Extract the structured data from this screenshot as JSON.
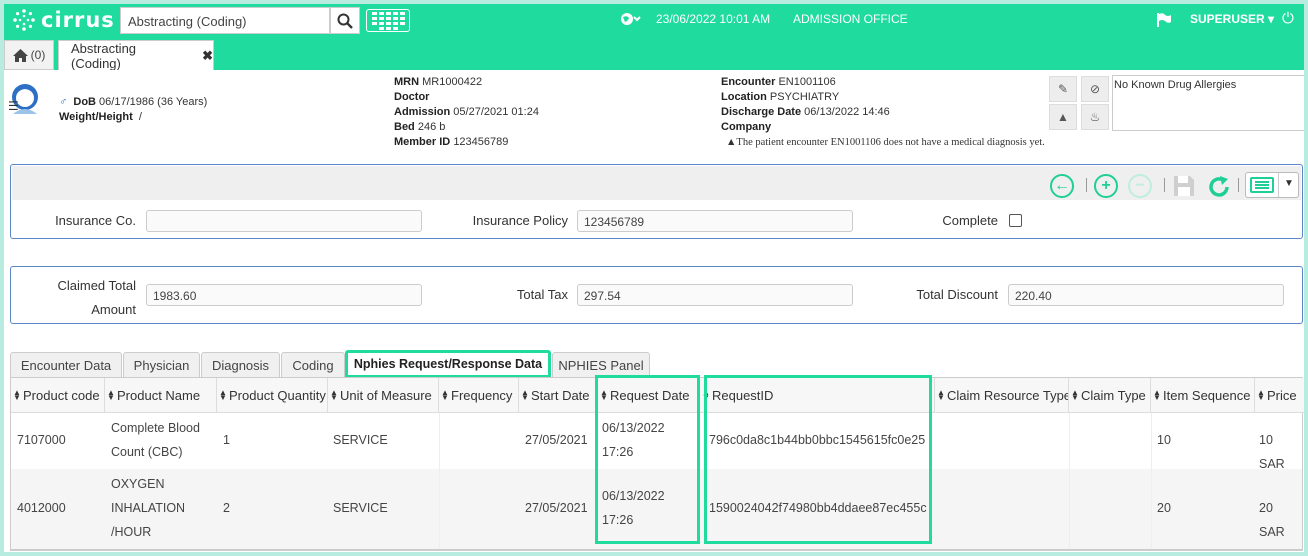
{
  "app": {
    "brand": "cirrus",
    "search_value": "Abstracting (Coding)",
    "datetime": "23/06/2022 10:01 AM",
    "office": "ADMISSION OFFICE",
    "user": "SUPERUSER",
    "accent": "#1fdb9e"
  },
  "tabs": {
    "home_label": "(0)",
    "work_label": "Abstracting (Coding)"
  },
  "patient": {
    "sex_symbol": "♂",
    "dob_label": "DoB",
    "dob": "06/17/1986 (36 Years)",
    "weight_label": "Weight/Height",
    "weight": "/",
    "mrn_label": "MRN",
    "mrn": "MR1000422",
    "doctor_label": "Doctor",
    "doctor": "",
    "admission_label": "Admission",
    "admission": "05/27/2021 01:24",
    "bed_label": "Bed",
    "bed": "246 b",
    "member_label": "Member ID",
    "member": "123456789",
    "encounter_label": "Encounter",
    "encounter": "EN1001106",
    "location_label": "Location",
    "location": "PSYCHIATRY",
    "discharge_label": "Discharge Date",
    "discharge": "06/13/2022 14:46",
    "company_label": "Company",
    "company": "",
    "warning": "The patient encounter EN1001106 does not have a medical diagnosis yet.",
    "allergy": "No Known Drug Allergies"
  },
  "form1": {
    "insurance_co_label": "Insurance Co.",
    "insurance_co": "",
    "policy_label": "Insurance Policy",
    "policy": "123456789",
    "complete_label": "Complete"
  },
  "form2": {
    "claimed_label": "Claimed Total Amount",
    "claimed_line1": "Claimed Total",
    "claimed_line2": "Amount",
    "claimed": "1983.60",
    "tax_label": "Total Tax",
    "tax": "297.54",
    "discount_label": "Total Discount",
    "discount": "220.40"
  },
  "detail_tabs": [
    "Encounter Data",
    "Physician",
    "Diagnosis",
    "Coding",
    "Nphies Request/Response Data",
    "NPHIES Panel"
  ],
  "table": {
    "headers": [
      "Product code",
      "Product Name",
      "Product Quantity",
      "Unit of Measure",
      "Frequency",
      "Start Date",
      "Request Date",
      "RequestID",
      "Claim Resource Type",
      "Claim Type",
      "Item Sequence",
      "Price"
    ],
    "rows": [
      {
        "code": "7107000",
        "name1": "Complete Blood",
        "name2": "Count (CBC)",
        "name3": "",
        "qty": "1",
        "unit": "SERVICE",
        "start": "27/05/2021",
        "req_date1": "06/13/2022",
        "req_date2": "17:26",
        "request_id": "796c0da8c1b44bb0bbc1545615fc0e25",
        "seq": "10",
        "price": "10 SAR"
      },
      {
        "code": "4012000",
        "name1": "OXYGEN",
        "name2": "INHALATION",
        "name3": "/HOUR",
        "qty": "2",
        "unit": "SERVICE",
        "start": "27/05/2021",
        "req_date1": "06/13/2022",
        "req_date2": "17:26",
        "request_id": "1590024042f74980bb4ddaee87ec455c",
        "seq": "20",
        "price": "20 SAR"
      }
    ]
  }
}
